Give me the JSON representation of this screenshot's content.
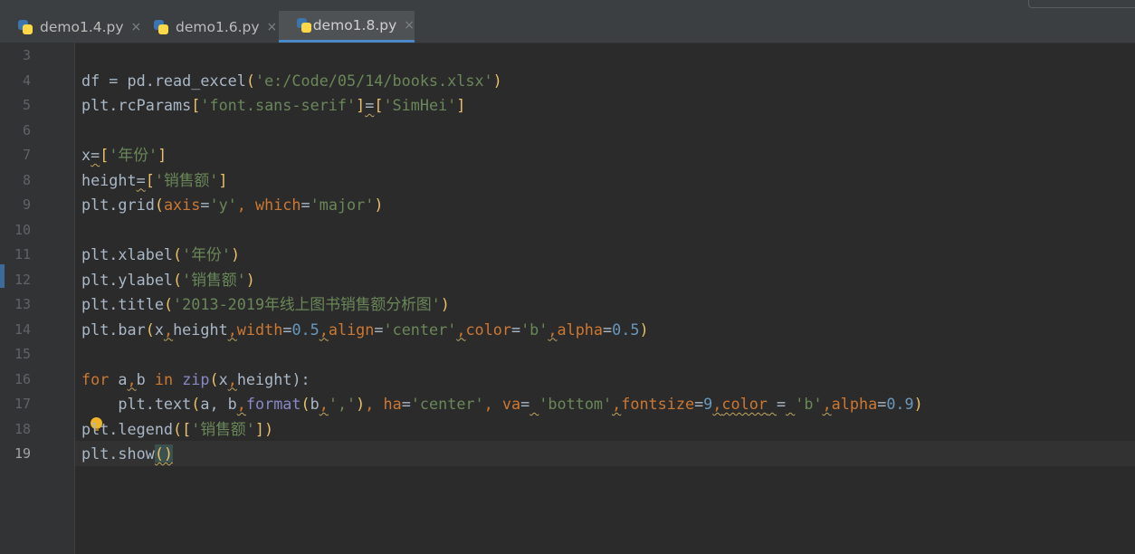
{
  "tabs": [
    {
      "label": "demo1.4.py",
      "active": false
    },
    {
      "label": "demo1.6.py",
      "active": false
    },
    {
      "label": "demo1.8.py",
      "active": true
    }
  ],
  "close_glyph": "×",
  "gutter": {
    "line_numbers": [
      "3",
      "4",
      "5",
      "6",
      "7",
      "8",
      "9",
      "10",
      "11",
      "12",
      "13",
      "14",
      "15",
      "16",
      "17",
      "18",
      "19"
    ],
    "current_line": "19"
  },
  "code": {
    "l4": {
      "a": "df = pd.read_excel",
      "b": "(",
      "c": "'e:/Code/05/14/books.xlsx'",
      "d": ")"
    },
    "l5": {
      "a": "plt.rcParams",
      "b": "[",
      "c": "'font.sans-serif'",
      "d": "]",
      "e": "=",
      "f": "[",
      "g": "'SimHei'",
      "h": "]"
    },
    "l7": {
      "a": "x",
      "b": "=",
      "c": "[",
      "d": "'年份'",
      "e": "]"
    },
    "l8": {
      "a": "height",
      "b": "=",
      "c": "[",
      "d": "'销售额'",
      "e": "]"
    },
    "l9": {
      "a": "plt.grid",
      "b": "(",
      "c": "axis",
      "d": "=",
      "e": "'y'",
      "f": ", ",
      "g": "which",
      "h": "=",
      "i": "'major'",
      "j": ")"
    },
    "l11": {
      "a": "plt.xlabel",
      "b": "(",
      "c": "'年份'",
      "d": ")"
    },
    "l12": {
      "a": "plt.ylabel",
      "b": "(",
      "c": "'销售额'",
      "d": ")"
    },
    "l13": {
      "a": "plt.title",
      "b": "(",
      "c": "'2013-2019年线上图书销售额分析图'",
      "d": ")"
    },
    "l14": {
      "a": "plt.bar",
      "b": "(",
      "c": "x",
      "d": ",",
      "e": "height",
      "f": ",",
      "g": "width",
      "h": "=",
      "i": "0.5",
      "j": ",",
      "k": "align",
      "l": "=",
      "m": "'center'",
      "n": ",",
      "o": "color",
      "p": "=",
      "q": "'b'",
      "r": ",",
      "s": "alpha",
      "t": "=",
      "u": "0.5",
      "v": ")"
    },
    "l16": {
      "a": "for",
      "b": " a",
      "c": ",",
      "d": "b ",
      "e": "in",
      "f": " ",
      "g": "zip",
      "h": "(",
      "i": "x",
      "j": ",",
      "k": "height",
      "l": "):"
    },
    "l17": {
      "a": "    plt.text",
      "b": "(",
      "c": "a, b",
      "d": ",",
      "e": "format",
      "f": "(",
      "g": "b",
      "h": ",",
      "i": "','",
      "j": ")",
      "k": ", ",
      "l": "ha",
      "m": "=",
      "n": "'center'",
      "o": ", ",
      "p": "va",
      "q": "=",
      "r": " ",
      "s": "'bottom'",
      "t": ",",
      "u": "fontsize",
      "v": "=",
      "w": "9",
      "x": ",",
      "y": "color",
      "z": " ",
      "aa": "=",
      "ab": " ",
      "ac": "'b'",
      "ad": ",",
      "ae": "alpha",
      "af": "=",
      "ag": "0.9",
      "ah": ")"
    },
    "l18": {
      "a": "plt.legend",
      "b": "(",
      "c": "[",
      "d": "'销售额'",
      "e": "]",
      "f": ")"
    },
    "l19": {
      "a": "plt.show",
      "b": "()"
    }
  }
}
